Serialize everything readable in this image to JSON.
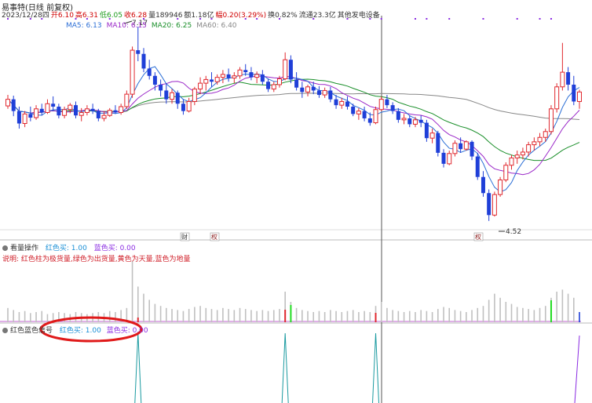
{
  "header": {
    "title": "易事特(日线 前复权)",
    "info": [
      {
        "text": "2023/12/28四",
        "color": "#333333"
      },
      {
        "text": "开6.10",
        "color": "#d00000"
      },
      {
        "text": "高6.31",
        "color": "#d00000"
      },
      {
        "text": "低6.05",
        "color": "#1a9a1a"
      },
      {
        "text": "收6.28",
        "color": "#d00000"
      },
      {
        "text": "量189946",
        "color": "#333333"
      },
      {
        "text": "额1.18亿",
        "color": "#333333"
      },
      {
        "text": "幅0.20(3.29%)",
        "color": "#d00000"
      },
      {
        "text": "换0.82%",
        "color": "#333333"
      },
      {
        "text": "流通23.3亿",
        "color": "#333333"
      },
      {
        "text": "其他发电设备",
        "color": "#333333"
      }
    ],
    "ma": [
      {
        "label": "MA5: 6.13",
        "color": "#2c6fd6"
      },
      {
        "label": "MA10: 6.15",
        "color": "#9a27c8"
      },
      {
        "label": "MA20: 6.25",
        "color": "#1a8f2a"
      },
      {
        "label": "MA60: 6.40",
        "color": "#888888"
      }
    ]
  },
  "markers": {
    "high_label": "7.17",
    "low_label": "4.52",
    "bottom_tags": [
      "财",
      "权",
      "权"
    ]
  },
  "panel_volume": {
    "title": "看量操作",
    "params": [
      {
        "text": "红色买: 1.00",
        "color": "#1a8fd6"
      },
      {
        "text": "蓝色买: 0.00",
        "color": "#8a2be2"
      }
    ],
    "note": "说明: 红色柱为极货量,绿色为出货量,黄色为天量,蓝色为地量"
  },
  "panel_signal": {
    "title": "红色蓝色信号",
    "params": [
      {
        "text": "红色买: 1.00",
        "color": "#1a8fd6"
      },
      {
        "text": "蓝色买: 0.00",
        "color": "#8a2be2"
      }
    ]
  },
  "colors": {
    "up": "#e0282e",
    "down": "#1f3fd8",
    "ma5": "#2c6fd6",
    "ma10": "#9a27c8",
    "ma20": "#1a8f2a",
    "ma60": "#888888",
    "vol_normal": "#c0c0c0",
    "vol_red": "#e0282e",
    "vol_green": "#22dd22",
    "vol_blue": "#1f3fd8",
    "signal_teal": "#1a9aa0",
    "signal_purple": "#8a2be2",
    "annotation": "#e01a1a"
  },
  "chart_data": [
    {
      "type": "candlestick",
      "title": "易事特(日线 前复权)",
      "ylim": [
        4.4,
        7.3
      ],
      "series": [
        {
          "name": "易事特",
          "values": [
            [
              6.09,
              6.24,
              6.05,
              6.18
            ],
            [
              6.18,
              6.23,
              5.95,
              6.02
            ],
            [
              6.02,
              6.08,
              5.78,
              5.85
            ],
            [
              5.85,
              6.02,
              5.8,
              5.98
            ],
            [
              5.98,
              6.08,
              5.88,
              5.93
            ],
            [
              5.93,
              6.1,
              5.9,
              6.05
            ],
            [
              6.05,
              6.12,
              5.96,
              6.0
            ],
            [
              6.0,
              6.18,
              5.98,
              6.12
            ],
            [
              6.12,
              6.22,
              6.02,
              6.08
            ],
            [
              6.08,
              6.12,
              5.92,
              5.96
            ],
            [
              5.96,
              6.08,
              5.92,
              6.04
            ],
            [
              6.04,
              6.13,
              5.99,
              6.1
            ],
            [
              6.1,
              6.15,
              5.92,
              5.96
            ],
            [
              5.96,
              6.06,
              5.88,
              6.0
            ],
            [
              6.0,
              6.1,
              5.96,
              6.05
            ],
            [
              6.05,
              6.12,
              5.98,
              6.02
            ],
            [
              6.02,
              6.05,
              5.88,
              5.92
            ],
            [
              5.92,
              6.02,
              5.88,
              5.96
            ],
            [
              5.96,
              6.06,
              5.94,
              6.03
            ],
            [
              6.03,
              6.1,
              5.98,
              6.0
            ],
            [
              6.0,
              6.12,
              5.97,
              6.08
            ],
            [
              6.08,
              6.3,
              6.05,
              6.25
            ],
            [
              6.25,
              6.9,
              6.2,
              6.85
            ],
            [
              6.85,
              7.17,
              6.7,
              6.8
            ],
            [
              6.8,
              6.88,
              6.55,
              6.6
            ],
            [
              6.6,
              6.72,
              6.45,
              6.5
            ],
            [
              6.5,
              6.55,
              6.3,
              6.38
            ],
            [
              6.38,
              6.45,
              6.22,
              6.3
            ],
            [
              6.3,
              6.4,
              6.12,
              6.18
            ],
            [
              6.18,
              6.32,
              6.12,
              6.27
            ],
            [
              6.27,
              6.3,
              6.05,
              6.12
            ],
            [
              6.12,
              6.18,
              5.97,
              6.02
            ],
            [
              6.02,
              6.2,
              6.0,
              6.15
            ],
            [
              6.15,
              6.35,
              6.1,
              6.32
            ],
            [
              6.32,
              6.48,
              6.25,
              6.4
            ],
            [
              6.4,
              6.5,
              6.3,
              6.45
            ],
            [
              6.45,
              6.55,
              6.35,
              6.42
            ],
            [
              6.42,
              6.52,
              6.38,
              6.48
            ],
            [
              6.48,
              6.58,
              6.4,
              6.52
            ],
            [
              6.52,
              6.6,
              6.42,
              6.47
            ],
            [
              6.47,
              6.55,
              6.4,
              6.5
            ],
            [
              6.5,
              6.62,
              6.46,
              6.58
            ],
            [
              6.58,
              6.66,
              6.5,
              6.55
            ],
            [
              6.55,
              6.62,
              6.44,
              6.48
            ],
            [
              6.48,
              6.56,
              6.4,
              6.52
            ],
            [
              6.52,
              6.58,
              6.38,
              6.42
            ],
            [
              6.42,
              6.46,
              6.28,
              6.32
            ],
            [
              6.32,
              6.42,
              6.28,
              6.38
            ],
            [
              6.38,
              6.5,
              6.34,
              6.46
            ],
            [
              6.46,
              6.82,
              6.44,
              6.72
            ],
            [
              6.72,
              6.78,
              6.4,
              6.45
            ],
            [
              6.45,
              6.55,
              6.3,
              6.34
            ],
            [
              6.34,
              6.42,
              6.2,
              6.28
            ],
            [
              6.28,
              6.38,
              6.22,
              6.35
            ],
            [
              6.35,
              6.42,
              6.25,
              6.3
            ],
            [
              6.3,
              6.36,
              6.2,
              6.24
            ],
            [
              6.24,
              6.34,
              6.2,
              6.3
            ],
            [
              6.3,
              6.35,
              6.14,
              6.18
            ],
            [
              6.18,
              6.24,
              6.05,
              6.1
            ],
            [
              6.1,
              6.2,
              6.05,
              6.15
            ],
            [
              6.15,
              6.22,
              6.04,
              6.08
            ],
            [
              6.08,
              6.12,
              5.95,
              5.98
            ],
            [
              5.98,
              6.06,
              5.9,
              6.02
            ],
            [
              6.02,
              6.08,
              5.88,
              5.92
            ],
            [
              5.92,
              6.0,
              5.82,
              5.86
            ],
            [
              5.86,
              6.08,
              5.84,
              6.04
            ],
            [
              6.04,
              6.22,
              6.02,
              6.18
            ],
            [
              6.18,
              6.24,
              6.06,
              6.1
            ],
            [
              6.1,
              6.14,
              5.98,
              6.02
            ],
            [
              6.02,
              6.06,
              5.86,
              5.9
            ],
            [
              5.9,
              5.98,
              5.84,
              5.92
            ],
            [
              5.92,
              5.96,
              5.8,
              5.84
            ],
            [
              5.84,
              5.94,
              5.8,
              5.9
            ],
            [
              5.9,
              5.96,
              5.8,
              5.86
            ],
            [
              5.86,
              5.9,
              5.6,
              5.65
            ],
            [
              5.65,
              5.78,
              5.58,
              5.72
            ],
            [
              5.72,
              5.75,
              5.4,
              5.45
            ],
            [
              5.45,
              5.5,
              5.25,
              5.3
            ],
            [
              5.3,
              5.48,
              5.28,
              5.44
            ],
            [
              5.44,
              5.62,
              5.4,
              5.58
            ],
            [
              5.58,
              5.66,
              5.45,
              5.5
            ],
            [
              5.5,
              5.62,
              5.48,
              5.6
            ],
            [
              5.6,
              5.62,
              5.35,
              5.4
            ],
            [
              5.4,
              5.45,
              5.08,
              5.12
            ],
            [
              5.12,
              5.2,
              4.85,
              4.9
            ],
            [
              4.9,
              4.95,
              4.52,
              4.6
            ],
            [
              4.6,
              4.92,
              4.58,
              4.88
            ],
            [
              4.88,
              5.12,
              4.85,
              5.08
            ],
            [
              5.08,
              5.32,
              5.05,
              5.28
            ],
            [
              5.28,
              5.42,
              5.22,
              5.38
            ],
            [
              5.38,
              5.48,
              5.3,
              5.42
            ],
            [
              5.42,
              5.52,
              5.36,
              5.46
            ],
            [
              5.46,
              5.6,
              5.4,
              5.56
            ],
            [
              5.56,
              5.66,
              5.48,
              5.6
            ],
            [
              5.6,
              5.72,
              5.54,
              5.66
            ],
            [
              5.66,
              5.78,
              5.6,
              5.74
            ],
            [
              5.74,
              6.1,
              5.7,
              6.05
            ],
            [
              6.05,
              6.4,
              6.0,
              6.35
            ],
            [
              6.35,
              6.95,
              6.3,
              6.55
            ],
            [
              6.55,
              6.62,
              6.3,
              6.38
            ],
            [
              6.38,
              6.5,
              6.1,
              6.15
            ],
            [
              6.15,
              6.31,
              6.05,
              6.28
            ]
          ]
        }
      ]
    },
    {
      "type": "bar",
      "title": "看量操作",
      "values": [
        14,
        12,
        10,
        11,
        9,
        10,
        11,
        8,
        9,
        10,
        9,
        8,
        10,
        9,
        8,
        9,
        10,
        9,
        11,
        10,
        12,
        14,
        60,
        35,
        28,
        22,
        18,
        16,
        14,
        13,
        12,
        11,
        13,
        15,
        16,
        14,
        13,
        12,
        14,
        13,
        12,
        14,
        13,
        12,
        11,
        12,
        11,
        12,
        13,
        30,
        20,
        14,
        12,
        11,
        10,
        11,
        10,
        12,
        11,
        10,
        11,
        12,
        10,
        11,
        10,
        16,
        20,
        14,
        12,
        11,
        10,
        11,
        10,
        12,
        11,
        10,
        13,
        15,
        14,
        12,
        11,
        10,
        12,
        14,
        16,
        22,
        28,
        24,
        20,
        18,
        15,
        14,
        13,
        12,
        14,
        16,
        24,
        30,
        32,
        28,
        24,
        10
      ],
      "colors": [
        "n",
        "n",
        "n",
        "n",
        "n",
        "n",
        "n",
        "n",
        "n",
        "n",
        "n",
        "n",
        "n",
        "n",
        "n",
        "n",
        "n",
        "n",
        "n",
        "n",
        "n",
        "n",
        "n",
        "n",
        "n",
        "n",
        "n",
        "n",
        "n",
        "n",
        "n",
        "n",
        "n",
        "n",
        "n",
        "n",
        "n",
        "n",
        "n",
        "n",
        "n",
        "n",
        "n",
        "n",
        "n",
        "n",
        "n",
        "n",
        "n",
        "n",
        "n",
        "n",
        "n",
        "n",
        "n",
        "n",
        "n",
        "n",
        "n",
        "n",
        "n",
        "n",
        "n",
        "n",
        "n",
        "n",
        "n",
        "n",
        "n",
        "n",
        "n",
        "n",
        "n",
        "n",
        "n",
        "n",
        "n",
        "n",
        "n",
        "n",
        "n",
        "n",
        "n",
        "n",
        "n",
        "n",
        "n",
        "n",
        "n",
        "n",
        "n",
        "n",
        "n",
        "n",
        "n",
        "n",
        "n",
        "n",
        "n",
        "n",
        "n",
        "b"
      ]
    },
    {
      "type": "line",
      "title": "红色蓝色信号",
      "series": [
        {
          "name": "红色买",
          "values": []
        }
      ]
    }
  ]
}
